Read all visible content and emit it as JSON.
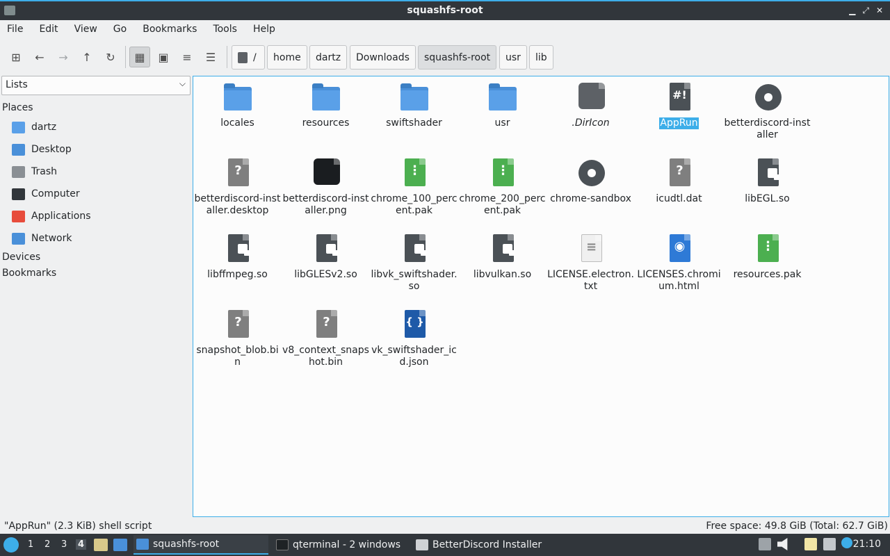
{
  "window": {
    "title": "squashfs-root",
    "minimize": "▁",
    "maximize": "⤢",
    "close": "✕"
  },
  "menu": [
    "File",
    "Edit",
    "View",
    "Go",
    "Bookmarks",
    "Tools",
    "Help"
  ],
  "toolbar": {
    "icons": [
      "new-tab-icon",
      "back-arrow-icon",
      "forward-arrow-icon",
      "up-arrow-icon",
      "reload-icon",
      "icon-view-icon",
      "thumbnail-view-icon",
      "compact-view-icon",
      "detailed-list-view-icon"
    ],
    "glyphs": {
      "new_tab": "⊞",
      "back": "←",
      "forward": "→",
      "up": "↑",
      "reload": "↻",
      "icon_view": "▦",
      "thumb_view": "▣",
      "compact_view": "≡",
      "detail_view": "☰"
    }
  },
  "breadcrumb": {
    "root": "/",
    "crumbs": [
      "home",
      "dartz",
      "Downloads",
      "squashfs-root",
      "usr",
      "lib"
    ],
    "current": "squashfs-root"
  },
  "sidebar": {
    "select_value": "Lists",
    "chevron": "⌵",
    "places_title": "Places",
    "places": [
      {
        "label": "dartz",
        "icon": "home-folder-icon",
        "color": "#5aa0e8"
      },
      {
        "label": "Desktop",
        "icon": "desktop-icon",
        "color": "#4a90d9"
      },
      {
        "label": "Trash",
        "icon": "trash-icon",
        "color": "#8a8f94"
      },
      {
        "label": "Computer",
        "icon": "computer-icon",
        "color": "#31363b"
      },
      {
        "label": "Applications",
        "icon": "applications-icon",
        "color": "#e74c3c"
      },
      {
        "label": "Network",
        "icon": "network-folder-icon",
        "color": "#4a90d9"
      }
    ],
    "devices_title": "Devices",
    "bookmarks_title": "Bookmarks"
  },
  "files": [
    {
      "name": "locales",
      "icon": "folder-icon"
    },
    {
      "name": "resources",
      "icon": "folder-icon"
    },
    {
      "name": "swiftshader",
      "icon": "folder-icon"
    },
    {
      "name": "usr",
      "icon": "folder-icon"
    },
    {
      "name": ".DirIcon",
      "icon": "symlink-image-icon"
    },
    {
      "name": "AppRun",
      "icon": "shell-script-icon",
      "mark": "#!"
    },
    {
      "name": "betterdiscord-installer",
      "icon": "executable-gear-icon"
    },
    {
      "name": "betterdiscord-installer.desktop",
      "icon": "unknown-file-warning-icon",
      "mark": "?"
    },
    {
      "name": "betterdiscord-installer.png",
      "icon": "png-image-icon"
    },
    {
      "name": "chrome_100_percent.pak",
      "icon": "archive-icon",
      "mark": "⋮"
    },
    {
      "name": "chrome_200_percent.pak",
      "icon": "archive-icon",
      "mark": "⋮"
    },
    {
      "name": "chrome-sandbox",
      "icon": "executable-gear-icon"
    },
    {
      "name": "icudtl.dat",
      "icon": "unknown-file-icon",
      "mark": "?"
    },
    {
      "name": "libEGL.so",
      "icon": "shared-library-icon"
    },
    {
      "name": "libffmpeg.so",
      "icon": "shared-library-icon"
    },
    {
      "name": "libGLESv2.so",
      "icon": "shared-library-icon"
    },
    {
      "name": "libvk_swiftshader.so",
      "icon": "shared-library-icon"
    },
    {
      "name": "libvulkan.so",
      "icon": "shared-library-icon"
    },
    {
      "name": "LICENSE.electron.txt",
      "icon": "text-file-icon",
      "mark": "≡"
    },
    {
      "name": "LICENSES.chromium.html",
      "icon": "html-file-icon",
      "mark": "◉"
    },
    {
      "name": "resources.pak",
      "icon": "archive-icon",
      "mark": "⋮"
    },
    {
      "name": "snapshot_blob.bin",
      "icon": "unknown-file-icon",
      "mark": "?"
    },
    {
      "name": "v8_context_snapshot.bin",
      "icon": "unknown-file-icon",
      "mark": "?"
    },
    {
      "name": "vk_swiftshader_icd.json",
      "icon": "json-file-icon",
      "mark": "{ }"
    }
  ],
  "selected": "AppRun",
  "status": {
    "left": "\"AppRun\" (2.3 KiB) shell script",
    "right": "Free space: 49.8 GiB (Total: 62.7 GiB)"
  },
  "taskbar": {
    "desktops": [
      "1",
      "2",
      "3",
      "4"
    ],
    "current_desktop": "4",
    "tasks": [
      {
        "label": "squashfs-root",
        "icon": "folder-icon"
      },
      {
        "label": "qterminal - 2 windows",
        "icon": "terminal-icon"
      },
      {
        "label": "BetterDiscord Installer",
        "icon": "window-icon"
      }
    ],
    "clock": "21:10"
  }
}
